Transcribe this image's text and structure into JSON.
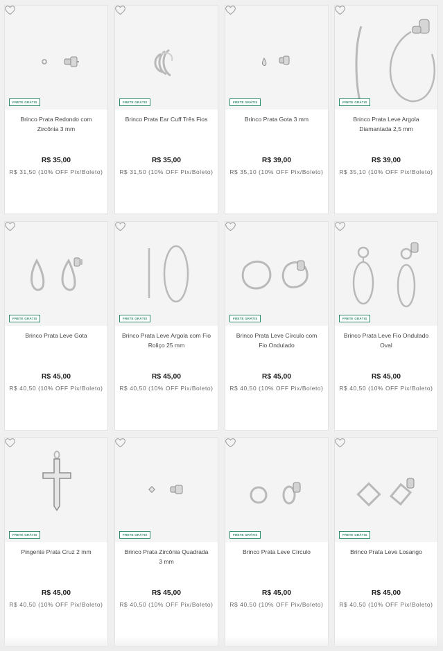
{
  "badge_label": "FRETE GRÁTIS",
  "accent_color": "#2e8b6e",
  "products": [
    {
      "name": "Brinco Prata Redondo com Zircônia 3 mm",
      "price": "R$ 35,00",
      "pix": "R$ 31,50 (10% OFF Pix/Boleto)",
      "icon": "stud-round-earring"
    },
    {
      "name": "Brinco Prata Ear Cuff Três Fios",
      "price": "R$ 35,00",
      "pix": "R$ 31,50 (10% OFF Pix/Boleto)",
      "icon": "ear-cuff"
    },
    {
      "name": "Brinco Prata Gota 3 mm",
      "price": "R$ 39,00",
      "pix": "R$ 35,10 (10% OFF Pix/Boleto)",
      "icon": "stud-drop-earring"
    },
    {
      "name": "Brinco Prata Leve Argola Diamantada 2,5 mm",
      "price": "R$ 39,00",
      "pix": "R$ 35,10 (10% OFF Pix/Boleto)",
      "icon": "hoop-earring"
    },
    {
      "name": "Brinco Prata Leve Gota",
      "price": "R$ 45,00",
      "pix": "R$ 40,50 (10% OFF Pix/Boleto)",
      "icon": "teardrop-earring"
    },
    {
      "name": "Brinco Prata Leve Argola com Fio Roliço 25 mm",
      "price": "R$ 45,00",
      "pix": "R$ 40,50 (10% OFF Pix/Boleto)",
      "icon": "thin-hoop-earring"
    },
    {
      "name": "Brinco Prata Leve Círculo com Fio Ondulado",
      "price": "R$ 45,00",
      "pix": "R$ 40,50 (10% OFF Pix/Boleto)",
      "icon": "wavy-circle-earring"
    },
    {
      "name": "Brinco Prata Leve Fio Ondulado Oval",
      "price": "R$ 45,00",
      "pix": "R$ 40,50 (10% OFF Pix/Boleto)",
      "icon": "oval-drop-earring"
    },
    {
      "name": "Pingente Prata Cruz 2 mm",
      "price": "R$ 45,00",
      "pix": "R$ 40,50 (10% OFF Pix/Boleto)",
      "icon": "cross-pendant"
    },
    {
      "name": "Brinco Prata Zircônia Quadrada 3 mm",
      "price": "R$ 45,00",
      "pix": "R$ 40,50 (10% OFF Pix/Boleto)",
      "icon": "stud-square-earring"
    },
    {
      "name": "Brinco Prata Leve Círculo",
      "price": "R$ 45,00",
      "pix": "R$ 40,50 (10% OFF Pix/Boleto)",
      "icon": "circle-earring"
    },
    {
      "name": "Brinco Prata Leve Losango",
      "price": "R$ 45,00",
      "pix": "R$ 40,50 (10% OFF Pix/Boleto)",
      "icon": "diamond-shape-earring"
    }
  ]
}
